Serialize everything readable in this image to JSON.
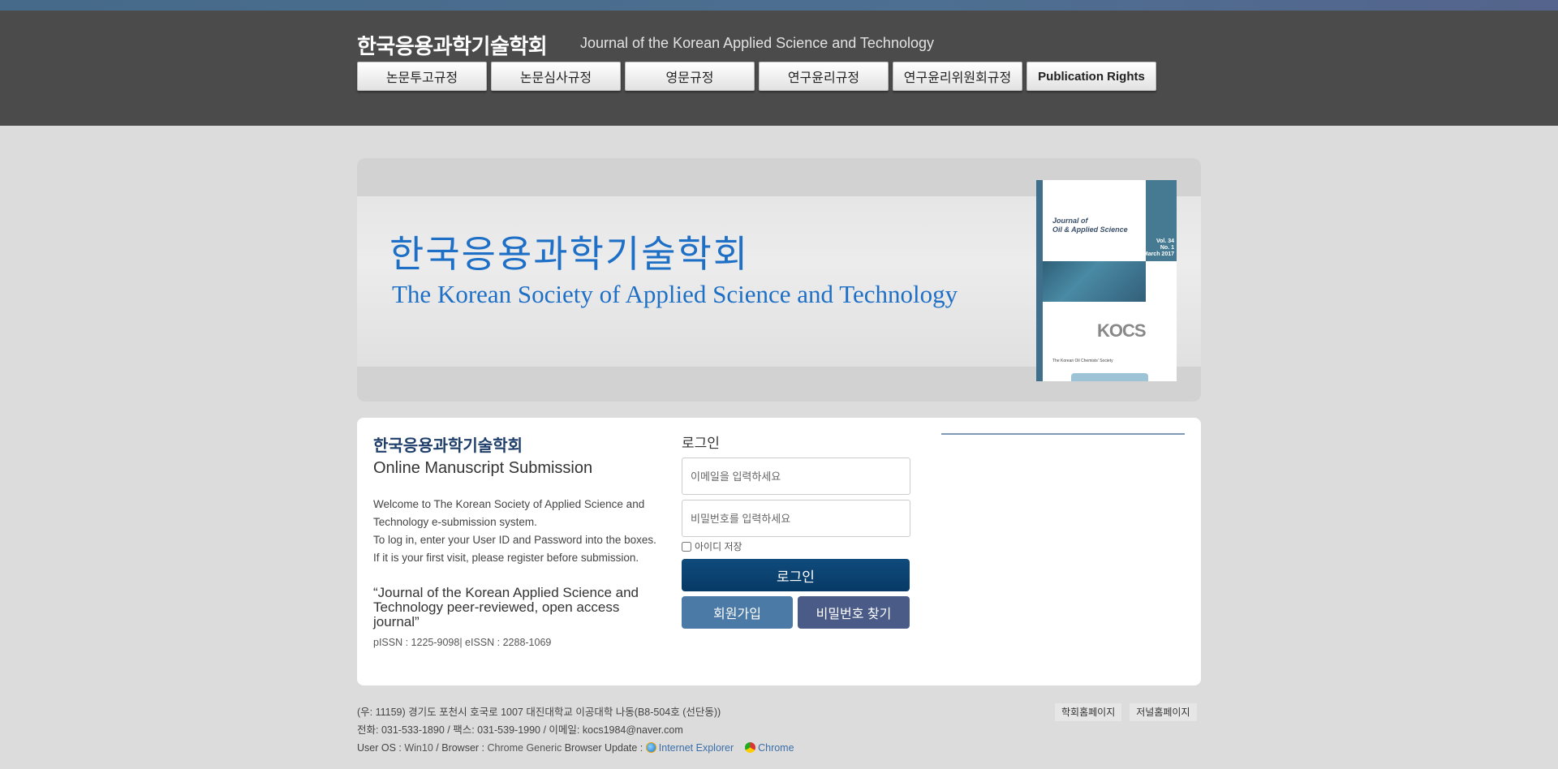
{
  "header": {
    "title": "한국응용과학기술학회",
    "subtitle": "Journal of the Korean Applied Science and Technology",
    "nav": [
      {
        "label": "논문투고규정"
      },
      {
        "label": "논문심사규정"
      },
      {
        "label": "영문규정"
      },
      {
        "label": "연구윤리규정"
      },
      {
        "label": "연구윤리위원회규정"
      },
      {
        "label": "Publication Rights"
      }
    ]
  },
  "banner": {
    "title_ko": "한국응용과학기술학회",
    "title_en": "The Korean Society of Applied Science and Technology",
    "cover": {
      "journal_title_line1": "Journal of",
      "journal_title_line2": "Oil & Applied Science",
      "vol": "Vol. 34",
      "no": "No. 1",
      "date": "March 2017",
      "logo": "KOCS",
      "publisher": "The Korean Oil Chemists' Society"
    }
  },
  "intro": {
    "title": "한국응용과학기술학회",
    "subtitle": "Online Manuscript Submission",
    "welcome_lines": [
      "Welcome to The Korean Society of Applied Science and",
      "Technology e-submission system.",
      "To log in, enter your User ID and Password into the boxes.",
      "If it is your first visit, please register before submission."
    ],
    "quote": "“Journal of the Korean Applied Science and Technology peer-reviewed, open access journal”",
    "issn": "pISSN : 1225-9098| eISSN : 2288-1069"
  },
  "login": {
    "label": "로그인",
    "email_placeholder": "이메일을 입력하세요",
    "password_placeholder": "비밀번호를 입력하세요",
    "remember_label": "아이디 저장",
    "login_button": "로그인",
    "join_button": "회원가입",
    "find_password_button": "비밀번호 찾기"
  },
  "footer": {
    "address": "(우: 11159) 경기도 포천시 호국로 1007 대진대학교 이공대학 나동(B8-504호 (선단동))",
    "contact": "전화: 031-533-1890 / 팩스: 031-539-1990 / 이메일: kocs1984@naver.com",
    "os_label": "User OS :",
    "os_value": "Win10",
    "browser_label": "/ Browser :",
    "browser_value": "Chrome Generic",
    "update_label": "Browser Update :",
    "ie_link": "Internet Explorer",
    "chrome_link": "Chrome",
    "links": [
      {
        "label": "학회홈페이지"
      },
      {
        "label": "저널홈페이지"
      }
    ]
  }
}
